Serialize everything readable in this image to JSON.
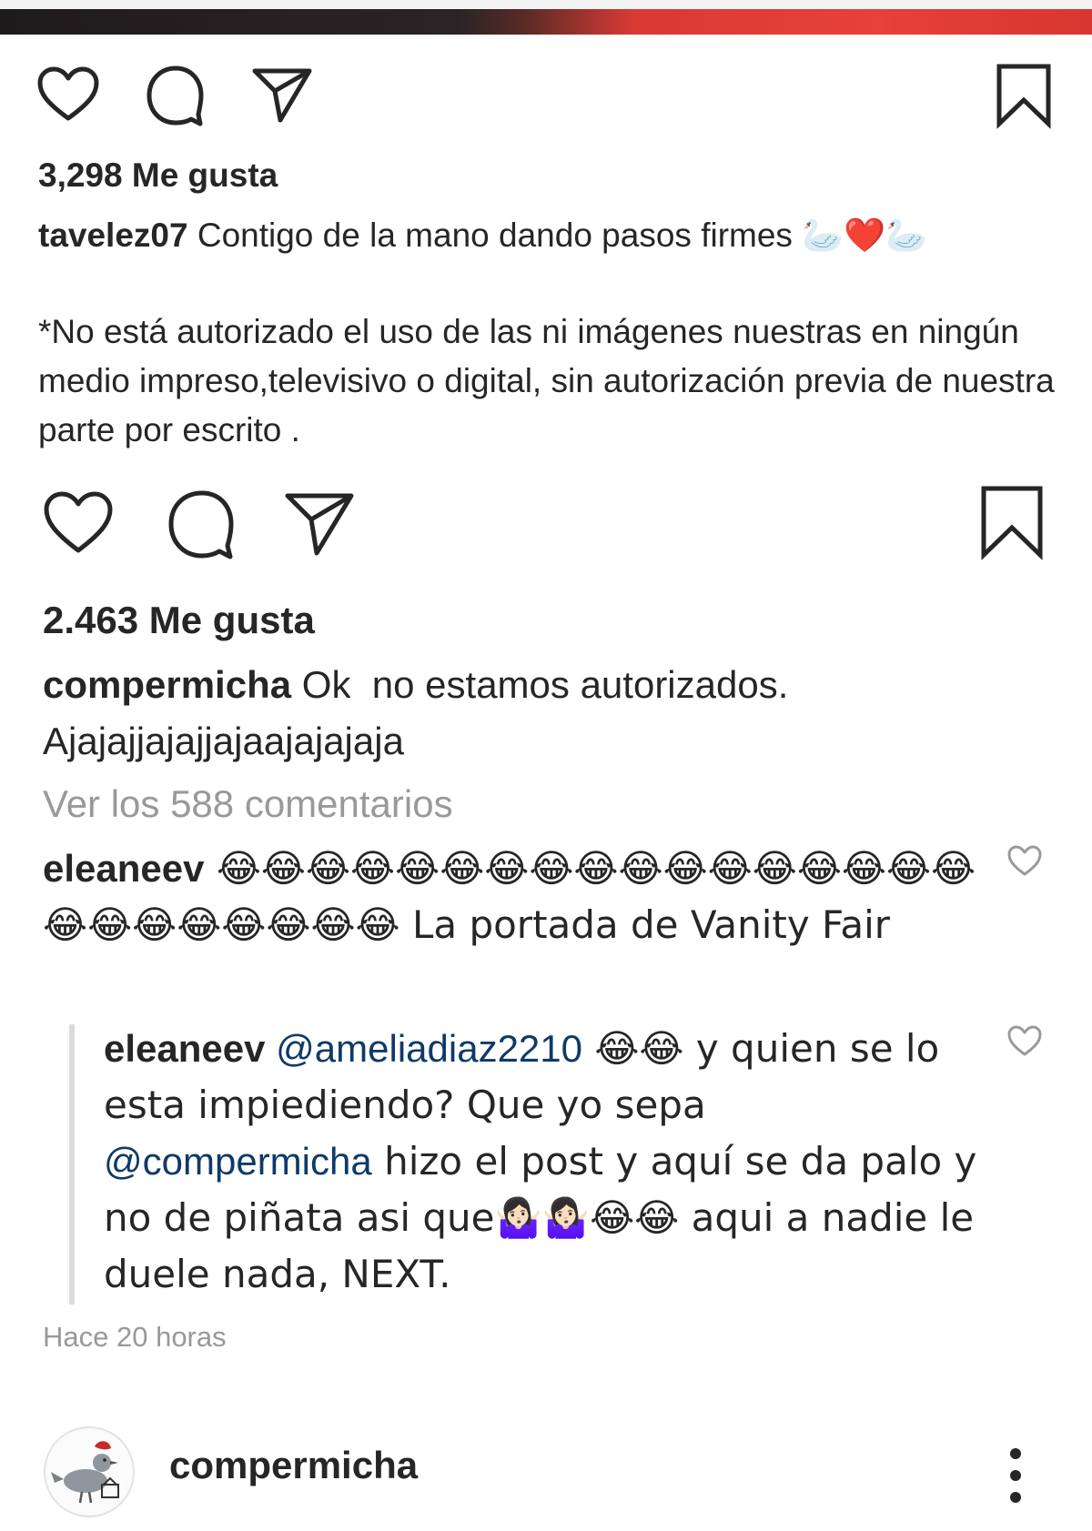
{
  "post1": {
    "likes": "3,298 Me gusta",
    "author": "tavelez07",
    "caption": " Contigo de la mano dando pasos firmes 🦢❤️🦢",
    "notice": "*No está autorizado el uso de las ni imágenes nuestras en ningún medio impreso,televisivo o digital, sin autorización previa de nuestra parte por escrito ."
  },
  "post2": {
    "likes": "2.463 Me gusta",
    "author": "compermicha",
    "caption": " Ok  no estamos autorizados. Ajajajjajajjajaajajajaja",
    "view_comments": "Ver los 588 comentarios"
  },
  "comment": {
    "author": "eleaneev",
    "text": " 😂😂😂😂😂😂😂😂😂😂😂😂😂😂😂😂😂😂😂😂😂😂😂😂😂 La portada de Vanity Fair"
  },
  "reply": {
    "author": "eleaneev",
    "mention1": "@ameliadiaz2210",
    "text1": " 😂😂 y quien se lo esta impiediendo? Que yo sepa ",
    "mention2": "@compermicha",
    "text2": " hizo el post y aquí se da palo y no de piñata asi que🤷🏻‍♀️🤷🏻‍♀️😂😂 aqui a nadie le duele nada, NEXT.",
    "timestamp": "Hace 20 horas"
  },
  "account": {
    "name": "compermicha"
  },
  "icons": {
    "like": "heart-icon",
    "comment": "comment-bubble-icon",
    "share": "send-icon",
    "save": "bookmark-icon",
    "more": "more-vertical-icon"
  },
  "colors": {
    "text": "#262626",
    "muted": "#999999",
    "mention": "#0e3a68"
  }
}
